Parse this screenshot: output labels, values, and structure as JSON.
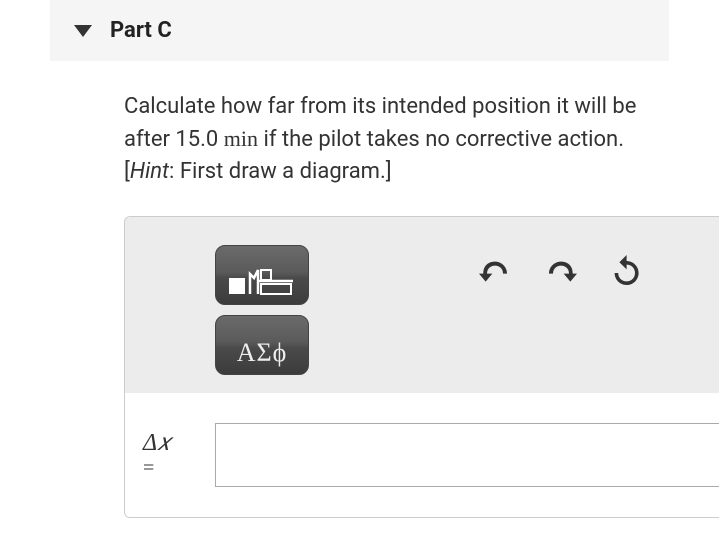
{
  "part": {
    "label": "Part C"
  },
  "question": {
    "prefix": "Calculate how far from its intended position it will be after 15.0",
    "time_unit": "min",
    "suffix": "if the pilot takes no corrective action. [",
    "hint_label": "Hint",
    "hint_text": ": First draw a diagram.]"
  },
  "toolbar": {
    "math_templates_label": "math-templates",
    "greek_label": "ΑΣϕ"
  },
  "answer": {
    "variable_line1": "Δ𝑥",
    "variable_line2": "=",
    "value": "",
    "placeholder": ""
  }
}
